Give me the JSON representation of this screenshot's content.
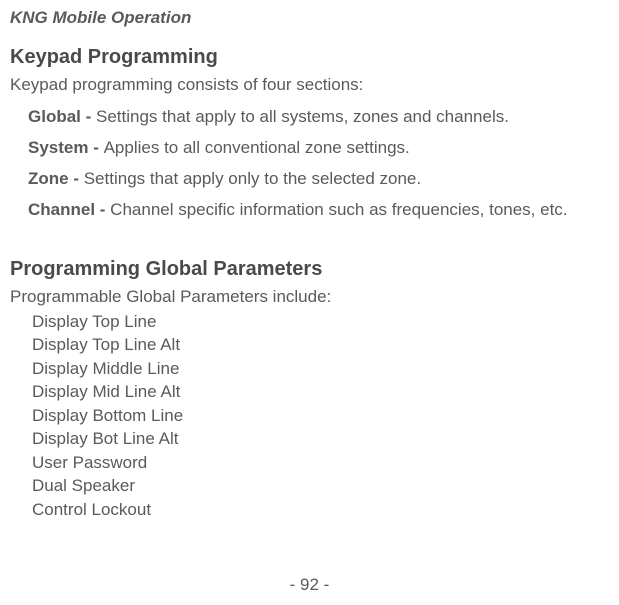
{
  "chapter": "KNG Mobile Operation",
  "section1": {
    "heading": "Keypad Programming",
    "intro": "Keypad programming consists of four sections:",
    "definitions": [
      {
        "term": "Global - ",
        "desc": "Settings that apply to all systems, zones and channels."
      },
      {
        "term": "System - ",
        "desc": "Applies to all conventional zone settings."
      },
      {
        "term": "Zone - ",
        "desc": "Settings that apply only to the selected zone."
      },
      {
        "term": "Channel - ",
        "desc": "Channel specific information such as frequencies, tones, etc."
      }
    ]
  },
  "section2": {
    "heading": "Programming Global Parameters",
    "intro": "Programmable Global Parameters include:",
    "params": [
      "Display Top Line",
      "Display Top Line Alt",
      "Display Middle Line",
      "Display Mid Line Alt",
      "Display Bottom Line",
      "Display Bot Line Alt",
      "User Password",
      "Dual Speaker",
      "Control Lockout"
    ]
  },
  "pageNumber": "- 92 -"
}
